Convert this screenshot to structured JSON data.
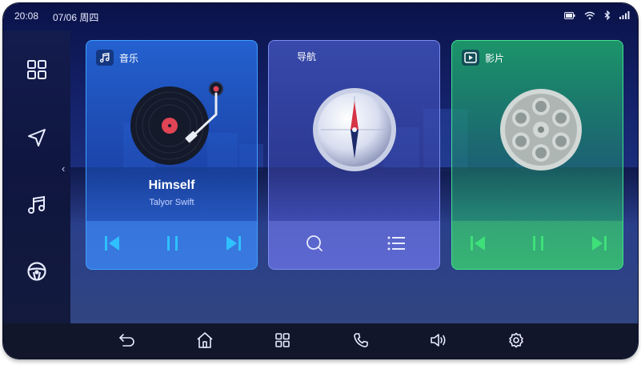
{
  "status_bar": {
    "time": "20:08",
    "date": "07/06 周四",
    "icons": [
      "battery-icon",
      "wifi-icon",
      "bluetooth-icon",
      "signal-icon"
    ]
  },
  "sidebar": {
    "items": [
      {
        "icon": "apps-grid-icon"
      },
      {
        "icon": "navigation-arrow-icon"
      },
      {
        "icon": "music-note-icon"
      },
      {
        "icon": "steering-wheel-icon"
      }
    ],
    "collapse_glyph": "‹"
  },
  "cards": {
    "music": {
      "title": "音乐",
      "song": "Himself",
      "artist": "Talyor Swift",
      "controls": [
        "previous-icon",
        "pause-icon",
        "next-icon"
      ]
    },
    "navigation": {
      "title": "导航",
      "controls": [
        "search-icon",
        "list-icon"
      ]
    },
    "video": {
      "title": "影片",
      "controls": [
        "previous-icon",
        "pause-icon",
        "next-icon"
      ]
    }
  },
  "dock": {
    "items": [
      "back-icon",
      "home-icon",
      "apps-icon",
      "phone-icon",
      "volume-icon",
      "settings-icon"
    ]
  },
  "colors": {
    "music_accent": "#3fa0ff",
    "navigation_accent": "#7c8df0",
    "video_accent": "#44e08e",
    "dock_background": "#11162b"
  }
}
